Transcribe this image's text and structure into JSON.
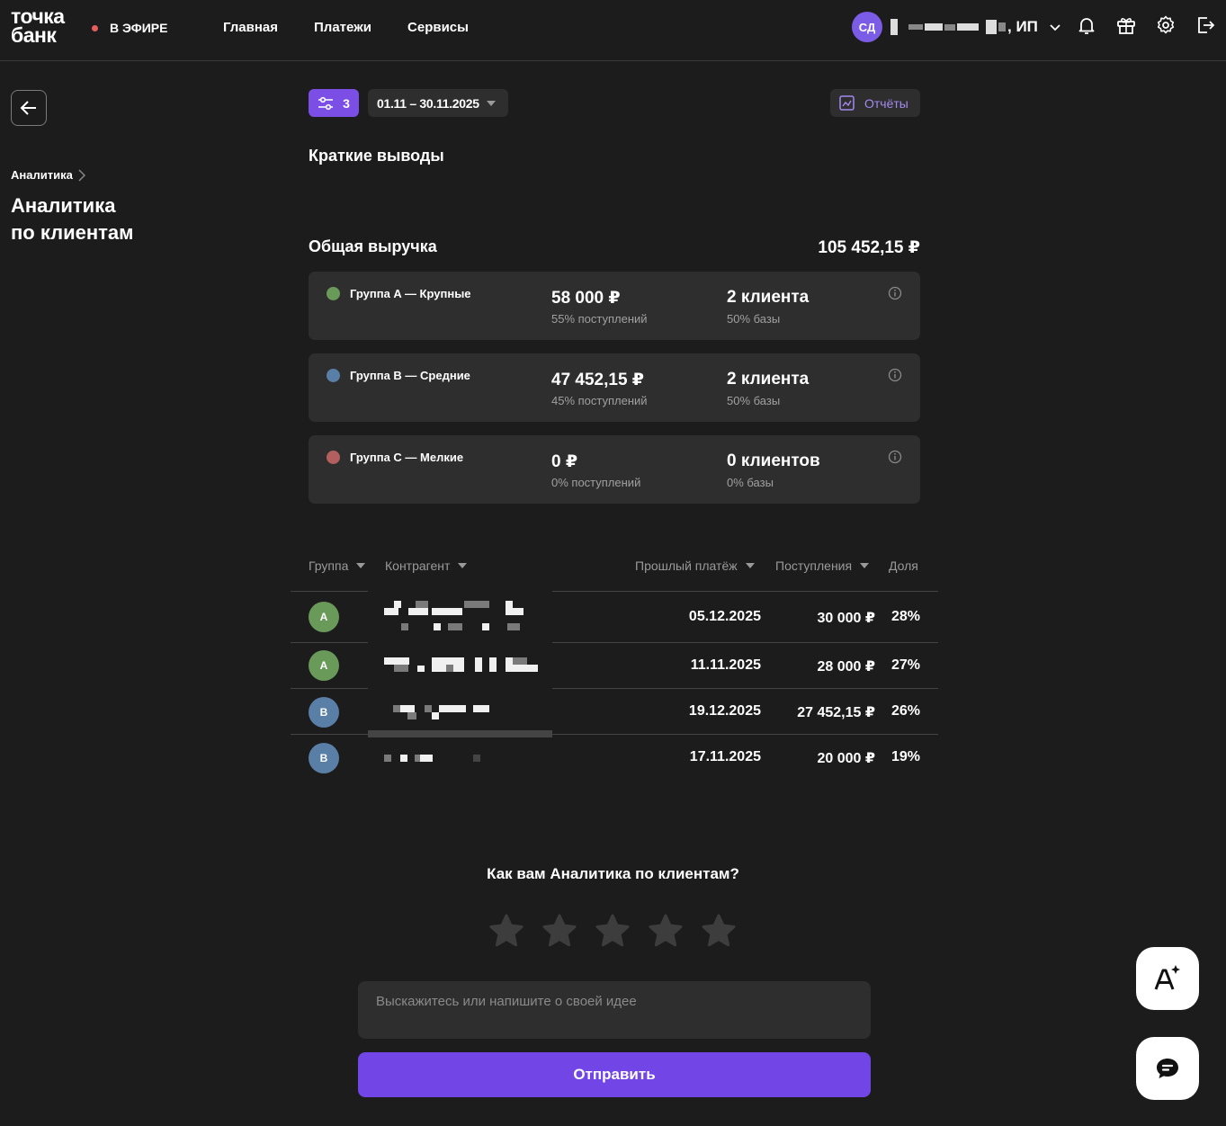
{
  "header": {
    "logo_line1": "точка",
    "logo_line2": "банк",
    "live_label": "В ЭФИРЕ",
    "nav": [
      "Главная",
      "Платежи",
      "Сервисы"
    ],
    "user_initials": "СД",
    "user_suffix": ", ИП"
  },
  "left": {
    "breadcrumb": "Аналитика",
    "page_title_line1": "Аналитика",
    "page_title_line2": "по клиентам"
  },
  "toolbar": {
    "filter_count": "3",
    "date_range": "01.11 – 30.11.2025",
    "reports_label": "Отчёты"
  },
  "summary": {
    "section_title": "Краткие выводы",
    "total_label": "Общая выручка",
    "total_value": "105 452,15 ₽",
    "groups": [
      {
        "name": "Группа A — Крупные",
        "color": "#6a9a5a",
        "amount": "58 000 ₽",
        "share": "55% поступлений",
        "clients": "2 клиента",
        "base": "50% базы"
      },
      {
        "name": "Группа B — Средние",
        "color": "#5a7fa6",
        "amount": "47 452,15 ₽",
        "share": "45% поступлений",
        "clients": "2 клиента",
        "base": "50% базы"
      },
      {
        "name": "Группа C — Мелкие",
        "color": "#b45f5f",
        "amount": "0 ₽",
        "share": "0% поступлений",
        "clients": "0 клиентов",
        "base": "0% базы"
      }
    ]
  },
  "table": {
    "headers": {
      "group": "Группа",
      "counterparty": "Контрагент",
      "last_payment": "Прошлый платёж",
      "income": "Поступления",
      "share": "Доля"
    },
    "rows": [
      {
        "group": "A",
        "color": "#6a9a5a",
        "date": "05.12.2025",
        "income": "30 000 ₽",
        "share": "28%"
      },
      {
        "group": "A",
        "color": "#6a9a5a",
        "date": "11.11.2025",
        "income": "28 000 ₽",
        "share": "27%"
      },
      {
        "group": "B",
        "color": "#5a7fa6",
        "date": "19.12.2025",
        "income": "27 452,15 ₽",
        "share": "26%"
      },
      {
        "group": "B",
        "color": "#5a7fa6",
        "date": "17.11.2025",
        "income": "20 000 ₽",
        "share": "19%"
      }
    ]
  },
  "feedback": {
    "title": "Как вам Аналитика по клиентам?",
    "placeholder": "Выскажитесь или напишите о своей идее",
    "send_label": "Отправить"
  }
}
